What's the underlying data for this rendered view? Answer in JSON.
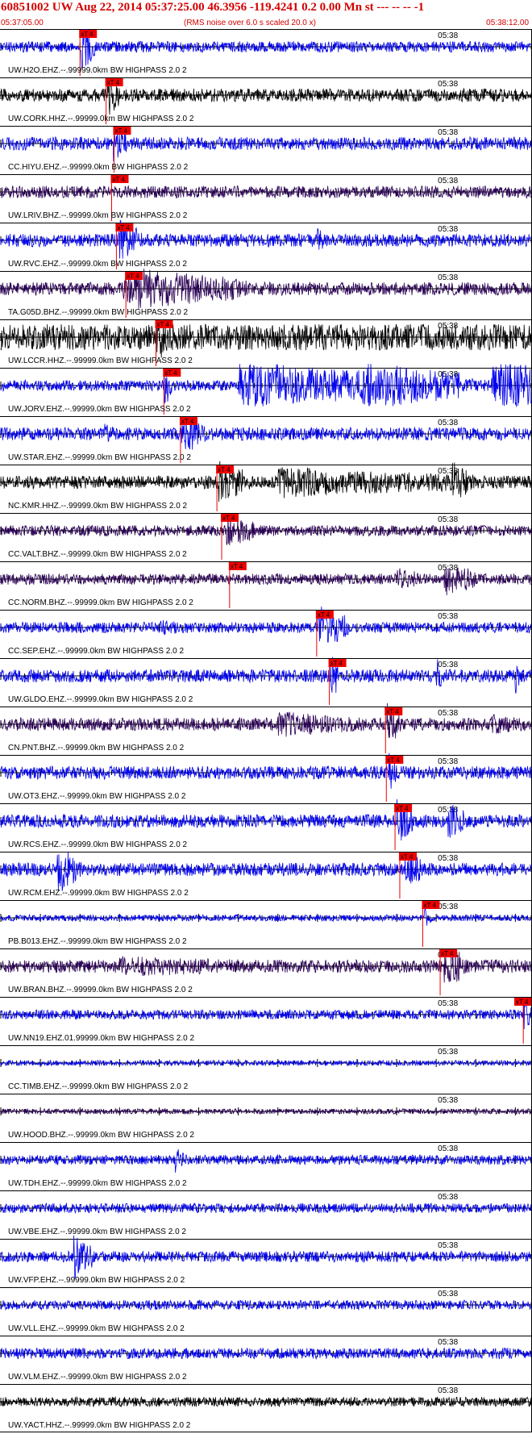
{
  "header": {
    "title": "60851002 UW Aug 22, 2014 05:37:25.00   46.3956 -119.4241  0.2 0.00 Mn st --- -- --   -1",
    "start_time": "05:37:05.00",
    "scale_note": "(RMS noise over 6.0 s scaled 20.0 x)",
    "end_time": "05:38:12.00"
  },
  "chart_data": {
    "type": "line",
    "x_range_seconds": [
      0,
      67
    ],
    "minute_label": "05:38",
    "minute_mark_seconds": 55,
    "pick_label": "xT 4",
    "colors": {
      "blue": "#0000ee",
      "navy": "#2a0055",
      "black": "#000000",
      "pick": "#ee0000",
      "axis": "#000000"
    },
    "traces": [
      {
        "label": "UW.H2O.EHZ.--.99999.0km BW  HIGHPASS  2.0  2",
        "color": "blue",
        "pick_seconds": 10.0,
        "amp": 0.25,
        "events": [
          [
            10.2,
            1.0,
            2.0
          ]
        ]
      },
      {
        "label": "UW.CORK.HHZ.--.99999.0km BW  HIGHPASS  2.0  2",
        "color": "black",
        "pick_seconds": 13.3,
        "amp": 0.3,
        "events": [
          [
            13.4,
            0.9,
            1.5
          ]
        ]
      },
      {
        "label": "CC.HIYU.EHZ.--.99999.0km BW  HIGHPASS  2.0  2",
        "color": "blue",
        "pick_seconds": 14.3,
        "amp": 0.3,
        "events": [
          [
            14.0,
            0.8,
            2.0
          ]
        ]
      },
      {
        "label": "UW.LRIV.BHZ.--.99999.0km BW  HIGHPASS  2.0  2",
        "color": "navy",
        "pick_seconds": 14.0,
        "amp": 0.28,
        "events": []
      },
      {
        "label": "UW.RVC.EHZ.--.99999.0km BW  HIGHPASS  2.0  2",
        "color": "blue",
        "pick_seconds": 14.6,
        "amp": 0.3,
        "events": [
          [
            14.8,
            0.8,
            3.0
          ],
          [
            40.0,
            0.5,
            1.0
          ]
        ]
      },
      {
        "label": "TA.G05D.BHZ.--.99999.0km BW  HIGHPASS  2.0  2",
        "color": "navy",
        "pick_seconds": 15.8,
        "amp": 0.3,
        "events": [
          [
            15.5,
            1.0,
            1.5
          ],
          [
            17.0,
            0.8,
            14.0
          ]
        ]
      },
      {
        "label": "UW.LCCR.HHZ.--.99999.0km BW  HIGHPASS  2.0  2",
        "color": "black",
        "pick_seconds": 19.6,
        "amp": 0.6,
        "events": [
          [
            19.6,
            1.0,
            2.0
          ]
        ]
      },
      {
        "label": "UW.JORV.EHZ.--.99999.0km BW  HIGHPASS  2.0  2",
        "color": "blue",
        "pick_seconds": 20.6,
        "amp": 0.25,
        "events": [
          [
            20.6,
            0.9,
            1.0
          ],
          [
            30.0,
            1.0,
            17.0
          ],
          [
            45.0,
            1.0,
            13.0
          ],
          [
            62.0,
            1.0,
            12.0
          ]
        ]
      },
      {
        "label": "UW.STAR.EHZ.--.99999.0km BW  HIGHPASS  2.0  2",
        "color": "blue",
        "pick_seconds": 22.7,
        "amp": 0.3,
        "events": [
          [
            22.8,
            0.9,
            3.0
          ],
          [
            13.0,
            0.4,
            2.0
          ]
        ]
      },
      {
        "label": "NC.KMR.HHZ.--.99999.0km BW  HIGHPASS  2.0  2",
        "color": "black",
        "pick_seconds": 27.3,
        "amp": 0.3,
        "events": [
          [
            27.5,
            1.0,
            3.5
          ],
          [
            35.0,
            0.6,
            25.0
          ],
          [
            57.0,
            0.9,
            2.0
          ]
        ]
      },
      {
        "label": "CC.VALT.BHZ.--.99999.0km BW  HIGHPASS  2.0  2",
        "color": "navy",
        "pick_seconds": 27.9,
        "amp": 0.25,
        "events": [
          [
            28.5,
            0.7,
            3.5
          ]
        ]
      },
      {
        "label": "CC.NORM.BHZ.--.99999.0km BW  HIGHPASS  2.0  2",
        "color": "navy",
        "pick_seconds": 28.9,
        "amp": 0.25,
        "events": [
          [
            50.0,
            0.5,
            3.0
          ],
          [
            56.0,
            0.7,
            4.0
          ]
        ]
      },
      {
        "label": "CC.SEP.EHZ.--.99999.0km BW  HIGHPASS  2.0  2",
        "color": "blue",
        "pick_seconds": 39.9,
        "amp": 0.25,
        "events": [
          [
            40.0,
            1.0,
            3.5
          ],
          [
            20.0,
            0.3,
            6.0
          ]
        ]
      },
      {
        "label": "UW.GLDO.EHZ.--.99999.0km BW  HIGHPASS  2.0  2",
        "color": "blue",
        "pick_seconds": 41.5,
        "amp": 0.3,
        "events": [
          [
            41.6,
            1.0,
            1.2
          ],
          [
            55.0,
            0.9,
            0.6
          ],
          [
            65.0,
            0.9,
            0.5
          ]
        ]
      },
      {
        "label": "CN.PNT.BHZ.--.99999.0km BW  HIGHPASS  2.0  2",
        "color": "navy",
        "pick_seconds": 48.6,
        "amp": 0.3,
        "events": [
          [
            48.8,
            1.0,
            1.5
          ],
          [
            35.0,
            0.5,
            12.0
          ],
          [
            62.0,
            0.4,
            5.0
          ]
        ]
      },
      {
        "label": "UW.OT3.EHZ.--.99999.0km BW  HIGHPASS  2.0  2",
        "color": "blue",
        "pick_seconds": 48.7,
        "amp": 0.3,
        "events": [
          [
            49.0,
            0.8,
            1.0
          ]
        ]
      },
      {
        "label": "UW.RCS.EHZ.--.99999.0km BW  HIGHPASS  2.0  2",
        "color": "blue",
        "pick_seconds": 49.8,
        "amp": 0.3,
        "events": [
          [
            50.0,
            1.0,
            2.0
          ],
          [
            56.5,
            0.8,
            2.0
          ]
        ]
      },
      {
        "label": "UW.RCM.EHZ.--.99999.0km BW  HIGHPASS  2.0  2",
        "color": "blue",
        "pick_seconds": 50.4,
        "amp": 0.3,
        "events": [
          [
            7.0,
            1.0,
            3.0
          ],
          [
            51.0,
            0.9,
            2.0
          ]
        ]
      },
      {
        "label": "PB.B013.EHZ.--.99999.0km BW  HIGHPASS  2.0  2",
        "color": "blue",
        "pick_seconds": 53.3,
        "amp": 0.15,
        "events": [
          [
            53.5,
            0.4,
            1.0
          ]
        ]
      },
      {
        "label": "UW.BRAN.BHZ.--.99999.0km BW  HIGHPASS  2.0  2",
        "color": "navy",
        "pick_seconds": 55.5,
        "amp": 0.3,
        "events": [
          [
            56.0,
            1.0,
            2.5
          ],
          [
            15.0,
            0.4,
            25.0
          ]
        ]
      },
      {
        "label": "UW.NN19.EHZ.01.99999.0km BW  HIGHPASS  2.0  2",
        "color": "blue",
        "pick_seconds": 66.0,
        "amp": 0.22,
        "events": [
          [
            66.0,
            0.7,
            1.0
          ]
        ]
      },
      {
        "label": "CC.TIMB.EHZ.--.99999.0km BW  HIGHPASS  2.0  2",
        "color": "blue",
        "pick_seconds": null,
        "amp": 0.12,
        "events": []
      },
      {
        "label": "UW.HOOD.BHZ.--.99999.0km BW  HIGHPASS  2.0  2",
        "color": "navy",
        "pick_seconds": null,
        "amp": 0.12,
        "events": []
      },
      {
        "label": "UW.TDH.EHZ.--.99999.0km BW  HIGHPASS  2.0  2",
        "color": "blue",
        "pick_seconds": null,
        "amp": 0.22,
        "events": [
          [
            22.0,
            0.5,
            1.5
          ]
        ]
      },
      {
        "label": "UW.VBE.EHZ.--.99999.0km BW  HIGHPASS  2.0  2",
        "color": "blue",
        "pick_seconds": null,
        "amp": 0.22,
        "events": []
      },
      {
        "label": "UW.VFP.EHZ.--.99999.0km BW  HIGHPASS  2.0  2",
        "color": "blue",
        "pick_seconds": null,
        "amp": 0.25,
        "events": [
          [
            9.0,
            0.9,
            2.5
          ]
        ]
      },
      {
        "label": "UW.VLL.EHZ.--.99999.0km BW  HIGHPASS  2.0  2",
        "color": "blue",
        "pick_seconds": null,
        "amp": 0.22,
        "events": []
      },
      {
        "label": "UW.VLM.EHZ.--.99999.0km BW  HIGHPASS  2.0  2",
        "color": "blue",
        "pick_seconds": null,
        "amp": 0.25,
        "events": []
      },
      {
        "label": "UW.YACT.HHZ.--.99999.0km BW  HIGHPASS  2.0  2",
        "color": "black",
        "pick_seconds": null,
        "amp": 0.22,
        "events": []
      }
    ]
  }
}
